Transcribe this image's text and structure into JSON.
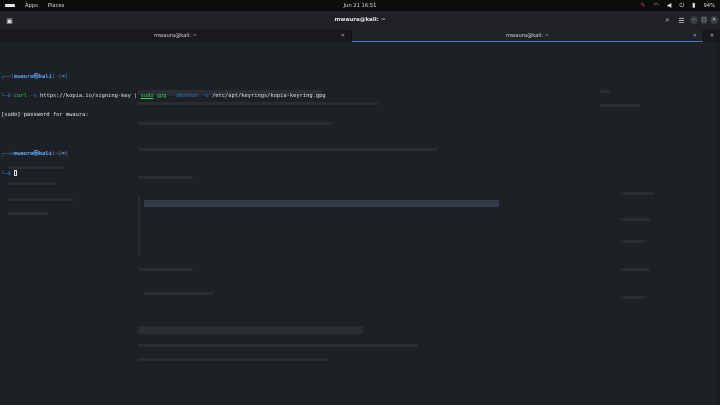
{
  "top_panel": {
    "apps": "Apps",
    "places": "Places",
    "clock": "Jun 21  16:51",
    "battery": "94%",
    "icons": [
      "activities-icon",
      "record-icon",
      "wifi-icon",
      "volume-icon",
      "power-icon"
    ]
  },
  "window": {
    "title": "mwaura@kali: ~"
  },
  "tabs": [
    {
      "label": "mwaura@kali: ~",
      "close": "✕"
    },
    {
      "label": "mwaura@kali: ~",
      "close": "✕"
    }
  ],
  "terminal": {
    "prompt1": {
      "corner": "┌──(",
      "user": "mwaura㉿kali",
      "mid": ")-[",
      "path": "~",
      "end": "]"
    },
    "cmd_prompt": "└─$ ",
    "cmd_curl": "curl",
    "cmd_flag1": " -s ",
    "cmd_url": "https://kopia.io/signing-key",
    "cmd_pipe": " | ",
    "cmd_sudo": "sudo",
    "cmd_gpg": " gpg",
    "cmd_flag2": " --dearmor",
    "cmd_flag3": " -o",
    "cmd_dest": " /etc/apt/keyrings/kopia-keyring.gpg",
    "sudo_prompt": "[sudo] password for mwaura:",
    "prompt2": {
      "corner": "┌──(",
      "user": "mwaura㉿kali",
      "mid": ")-[",
      "path": "~",
      "end": "]"
    },
    "prompt2_tail": "└─$ "
  },
  "colors": {
    "panel_bg": "#0b0c0e",
    "terminal_bg": "#1d2025",
    "prompt_blue": "#2f7fd8",
    "user_blue": "#5ba3f5",
    "cmd_green": "#3ecf5a",
    "tab_accent": "#3a7bd5"
  }
}
